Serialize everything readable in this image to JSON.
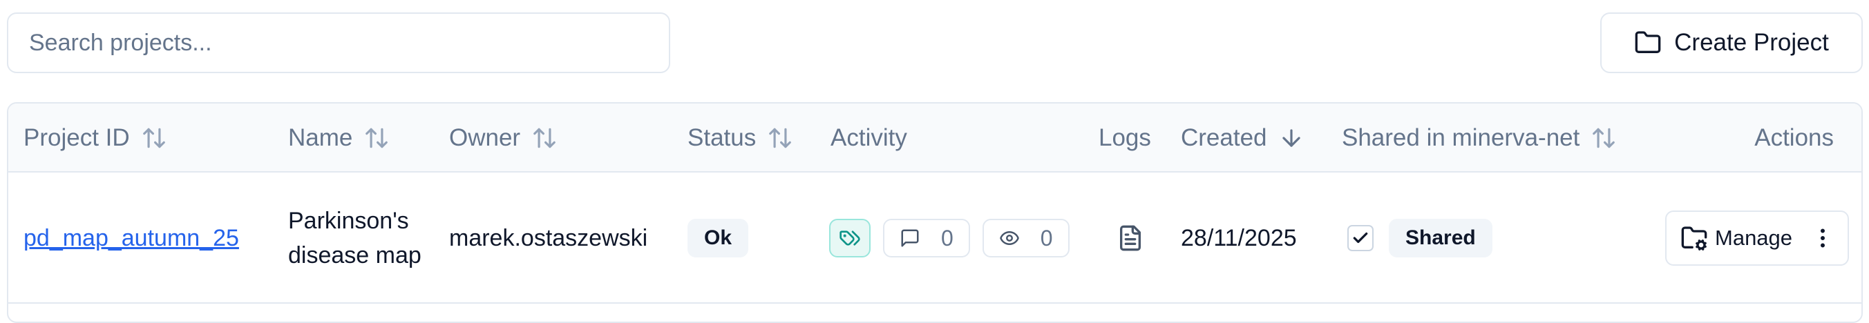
{
  "toolbar": {
    "search_placeholder": "Search projects...",
    "search_value": "",
    "create_label": "Create Project"
  },
  "table": {
    "headers": {
      "project_id": "Project ID",
      "name": "Name",
      "owner": "Owner",
      "status": "Status",
      "activity": "Activity",
      "logs": "Logs",
      "created": "Created",
      "shared": "Shared in minerva-net",
      "actions": "Actions"
    },
    "rows": [
      {
        "project_id": "pd_map_autumn_25",
        "name": "Parkinson's disease map",
        "owner": "marek.ostaszewski",
        "status": "Ok",
        "comments": "0",
        "views": "0",
        "created": "28/11/2025",
        "shared_checked": true,
        "shared_label": "Shared",
        "manage_label": "Manage"
      }
    ]
  },
  "colors": {
    "border": "#e2e8f0",
    "header_bg": "#f8fafc",
    "muted_text": "#64748b",
    "link": "#2563eb",
    "teal": "#0d9488",
    "badge_bg": "#f1f5f9"
  },
  "icons": {
    "create": "folder-icon",
    "sort": "sort-arrows-icon",
    "sort_desc": "arrow-down-icon",
    "tag": "tag-icon",
    "comments": "message-square-icon",
    "views": "eye-icon",
    "logs": "file-text-icon",
    "check": "check-icon",
    "manage": "folder-cog-icon",
    "more": "more-vertical-icon"
  }
}
